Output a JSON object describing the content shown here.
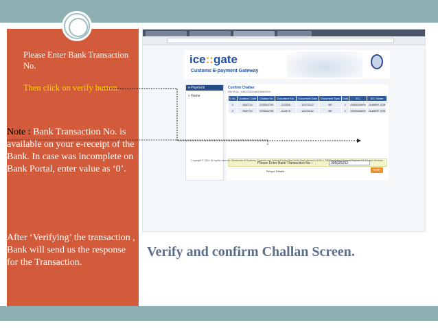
{
  "slide": {
    "instruction_1": "Please Enter Bank Transaction No.",
    "instruction_2": "Then click on verify button.",
    "note_label": "Note :",
    "note_text": " Bank Transaction No. is available on your e-receipt of the Bank. In case was incomplete on Bank Portal, enter value as ‘0’.",
    "after_text": "After ‘Verifying’ the transaction , Bank will send us the response for the Transaction.",
    "caption": "Verify and confirm Challan Screen."
  },
  "gateway": {
    "logo_left": "ice",
    "logo_colon": "::",
    "logo_right": "gate",
    "subtitle": "Customs E-payment Gateway",
    "nav_header": "e-Payment",
    "nav_home": "» Home",
    "content_title": "Confirm Challan",
    "ref_line": "Ref ID is : 5394753204A2394K294",
    "table": {
      "headers": [
        "S.No.",
        "Location Code",
        "Challan No.",
        "Document No.",
        "Document Date",
        "Document Type",
        "Duty",
        "IEC",
        "IEC Name"
      ],
      "rows": [
        [
          "1",
          "INATG4",
          "633260740",
          "212055",
          "12072012",
          "BE",
          "1",
          "0000000000",
          "DUMMY JOB"
        ],
        [
          "2",
          "INATG4",
          "633260705",
          "212015",
          "12072012",
          "BE",
          "1",
          "0000000000",
          "DUMMY JOB"
        ]
      ]
    },
    "bank_label": "Please Enter Bank Transaction No. :",
    "bank_value": "395025252",
    "retype_label": "Retype Details :",
    "verify_label": "Verify",
    "footer": "Copyright © 2011. All rights reserved. Directorate of Systems, Customs and Central Excise New Delhi. Best Viewed at 1024 x 768 Resolution | Internet Explorer 6.0 & Later Versions"
  },
  "colors": {
    "panel": "#d25b3c",
    "band": "#8fb0b2",
    "highlight": "#ffd400",
    "caption": "#5c6e8a",
    "verify": "#e8902a"
  }
}
